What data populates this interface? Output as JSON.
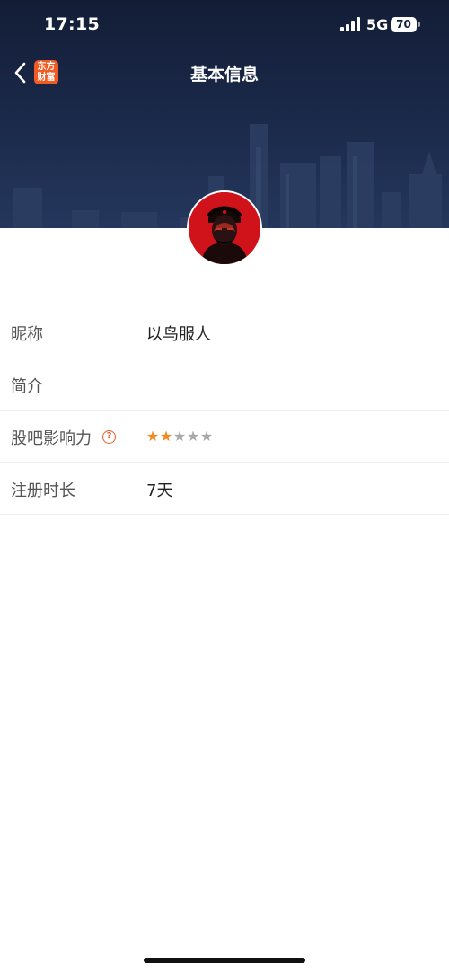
{
  "status_bar": {
    "time": "17:15",
    "network": "5G",
    "battery": "70"
  },
  "nav": {
    "title": "基本信息",
    "logo_line1": "东方",
    "logo_line2": "财富",
    "logo_color": "#f15a22"
  },
  "profile": {
    "rows": [
      {
        "label": "昵称",
        "value": "以鸟服人"
      },
      {
        "label": "简介",
        "value": ""
      },
      {
        "label": "股吧影响力",
        "rating": 2,
        "rating_max": 5
      },
      {
        "label": "注册时长",
        "value": "7天"
      }
    ]
  },
  "icons": {
    "back": "chevron-left-icon",
    "help": "question-circle-icon",
    "signal": "signal-bars-icon",
    "star": "star-icon"
  },
  "colors": {
    "header_bg": "#1b2a4b",
    "star_on": "#f08a24",
    "star_off": "#a9a9a9",
    "help_icon": "#e0602a"
  }
}
